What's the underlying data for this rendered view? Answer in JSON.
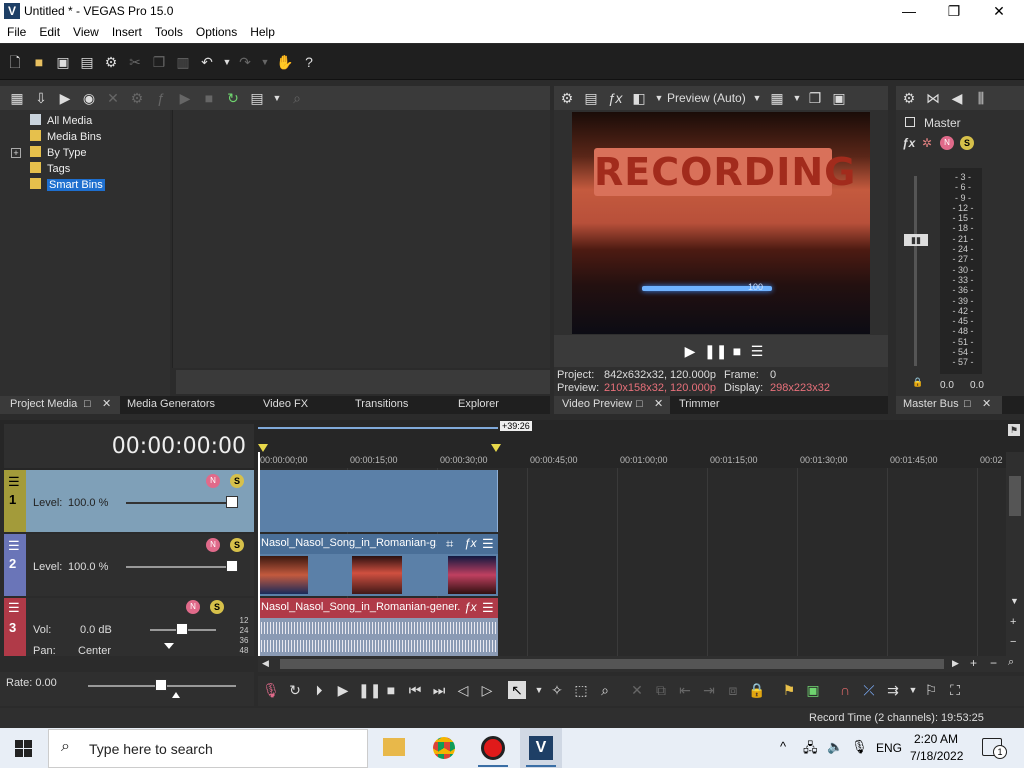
{
  "window": {
    "title": "Untitled * - VEGAS Pro 15.0",
    "icon": "V"
  },
  "window_controls": {
    "minimize": "—",
    "maximize": "❐",
    "close": "✕"
  },
  "menu": [
    "File",
    "Edit",
    "View",
    "Insert",
    "Tools",
    "Options",
    "Help"
  ],
  "project_media": {
    "tree": [
      {
        "label": "All Media"
      },
      {
        "label": "Media Bins"
      },
      {
        "label": "By Type",
        "expander": "+"
      },
      {
        "label": "Tags"
      },
      {
        "label": "Smart Bins",
        "selected": true
      }
    ]
  },
  "left_tabs": [
    "Project Media",
    "Media Generators",
    "Video FX",
    "Transitions",
    "Explorer"
  ],
  "preview": {
    "mode_label": "Preview (Auto)",
    "overlay_text": "RECORDING",
    "overlay_small": "100",
    "project_label": "Project:",
    "project_value": "842x632x32, 120.000p",
    "frame_label": "Frame:",
    "frame_value": "0",
    "preview_label": "Preview:",
    "preview_value": "210x158x32, 120.000p",
    "display_label": "Display:",
    "display_value": "298x223x32"
  },
  "mid_tabs": [
    "Video Preview",
    "Trimmer"
  ],
  "master": {
    "label": "Master",
    "scale": [
      "3",
      "6",
      "9",
      "12",
      "15",
      "18",
      "21",
      "24",
      "27",
      "30",
      "33",
      "36",
      "39",
      "42",
      "45",
      "48",
      "51",
      "54",
      "57"
    ],
    "left_value": "0.0",
    "right_value": "0.0"
  },
  "right_tabs": [
    "Master Bus"
  ],
  "timeline": {
    "timecode": "00:00:00:00",
    "region_length": "+39:26",
    "ruler": [
      "00:00:00;00",
      "00:00:15;00",
      "00:00:30;00",
      "00:00:45;00",
      "00:01:00;00",
      "00:01:15;00",
      "00:01:30;00",
      "00:01:45;00",
      "00:02"
    ],
    "tracks": [
      {
        "num": "1",
        "label": "Level:",
        "value": "100.0 %"
      },
      {
        "num": "2",
        "label": "Level:",
        "value": "100.0 %"
      },
      {
        "num": "3",
        "vol_label": "Vol:",
        "vol_value": "0.0 dB",
        "pan_label": "Pan:",
        "pan_value": "Center",
        "scale": [
          "12",
          "24",
          "36",
          "48"
        ]
      }
    ],
    "events": {
      "video": "Nasol_Nasol_Song_in_Romanian-g...",
      "audio": "Nasol_Nasol_Song_in_Romanian-gener..."
    },
    "rate": "Rate: 0.00"
  },
  "status": {
    "record_time": "Record Time (2 channels): 19:53:25"
  },
  "taskbar": {
    "search_placeholder": "Type here to search",
    "lang": "ENG",
    "time": "2:20 AM",
    "date": "7/18/2022",
    "notifications": "1"
  },
  "colors": {
    "accent": "#1e6fcf",
    "track1": "#7fa0b8",
    "track3": "#b03a48",
    "event_video": "#5b80a8",
    "event_audio": "#8a9ab4"
  }
}
